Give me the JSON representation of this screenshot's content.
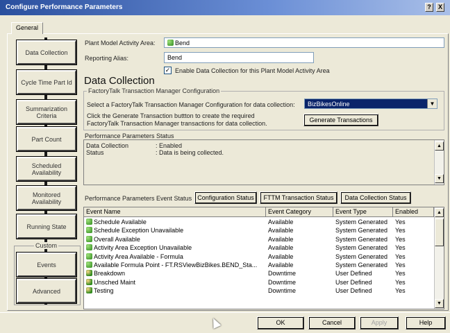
{
  "window": {
    "title": "Configure Performance Parameters",
    "help_button": "?",
    "close_button": "X"
  },
  "tab": {
    "general": "General"
  },
  "nav": {
    "items": [
      {
        "label": "Data Collection"
      },
      {
        "label": "Cycle Time Part Id"
      },
      {
        "label": "Summarization Criteria"
      },
      {
        "label": "Part Count"
      },
      {
        "label": "Scheduled Availability"
      },
      {
        "label": "Monitored Availability"
      },
      {
        "label": "Running State"
      }
    ],
    "custom_label": "Custom",
    "custom_items": [
      {
        "label": "Events"
      },
      {
        "label": "Advanced"
      }
    ]
  },
  "form": {
    "activity_area_label": "Plant Model Activity Area:",
    "activity_area_value": "Bend",
    "alias_label": "Reporting Alias:",
    "alias_value": "Bend",
    "enable_label": "Enable Data Collection for this Plant Model Activity Area",
    "enable_checked": true,
    "section_title": "Data Collection"
  },
  "fttm": {
    "group_title": "FactoryTalk Transaction Manager Configuration",
    "select_label": "Select a FactoryTalk Transaction Manager Configuration for data collection:",
    "selected_config": "BizBikesOnline",
    "description_line1": "Click the Generate Transaction buttton to create the required",
    "description_line2": "FactoryTalk Transaction Manager transactions for data collection.",
    "generate_button": "Generate Transactions"
  },
  "status": {
    "title": "Performance Parameters Status",
    "rows": [
      {
        "key": "Data Collection",
        "value": ": Enabled"
      },
      {
        "key": "Status",
        "value": ": Data is being collected."
      }
    ]
  },
  "event_status": {
    "label": "Performance Parameters Event Status",
    "buttons": [
      "Configuration Status",
      "FTTM Transaction Status",
      "Data Collection Status"
    ],
    "columns": [
      "Event Name",
      "Event Category",
      "Event Type",
      "Enabled"
    ],
    "rows": [
      {
        "name": "Schedule Available",
        "category": "Available",
        "type": "System Generated",
        "enabled": "Yes",
        "icon": "available-event-icon"
      },
      {
        "name": "Schedule Exception Unavailable",
        "category": "Available",
        "type": "System Generated",
        "enabled": "Yes",
        "icon": "available-event-icon"
      },
      {
        "name": "Overall Available",
        "category": "Available",
        "type": "System Generated",
        "enabled": "Yes",
        "icon": "available-event-icon"
      },
      {
        "name": "Activity Area Exception Unavailable",
        "category": "Available",
        "type": "System Generated",
        "enabled": "Yes",
        "icon": "available-event-icon"
      },
      {
        "name": "Activity Area Available - Formula",
        "category": "Available",
        "type": "System Generated",
        "enabled": "Yes",
        "icon": "available-event-icon"
      },
      {
        "name": "Available Formula Point - FT.RSViewBizBikes.BEND_Sta...",
        "category": "Available",
        "type": "System Generated",
        "enabled": "Yes",
        "icon": "available-event-icon"
      },
      {
        "name": "Breakdown",
        "category": "Downtime",
        "type": "User Defined",
        "enabled": "Yes",
        "icon": "downtime-event-icon"
      },
      {
        "name": "Unsched Maint",
        "category": "Downtime",
        "type": "User Defined",
        "enabled": "Yes",
        "icon": "downtime-event-icon"
      },
      {
        "name": "Testing",
        "category": "Downtime",
        "type": "User Defined",
        "enabled": "Yes",
        "icon": "downtime-event-icon"
      }
    ]
  },
  "footer": {
    "ok": "OK",
    "cancel": "Cancel",
    "apply": "Apply",
    "help": "Help"
  }
}
